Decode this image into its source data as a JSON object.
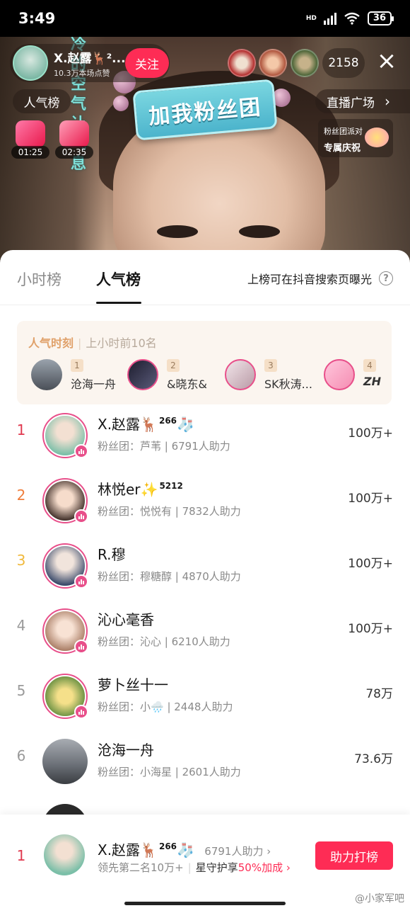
{
  "status": {
    "time": "3:49",
    "hd": "HD",
    "battery": "36"
  },
  "stream": {
    "sign_text": "加我粉丝团",
    "vert_text": "冷的空气让气息",
    "streamer_name": "X.赵露🦌²...",
    "streamer_likes": "10.3万本场点赞",
    "follow": "关注",
    "viewer_count": "2158",
    "popularity_chip": "人气榜",
    "plaza_chip": "直播广场",
    "gift_timers": [
      "01:25",
      "02:35"
    ],
    "fan_party": {
      "line1": "粉丝团派对",
      "line2": "专属庆祝"
    }
  },
  "tabs": {
    "hourly": "小时榜",
    "popularity": "人气榜",
    "exposure": "上榜可在抖音搜索页曝光",
    "help": "?"
  },
  "moment": {
    "title": "人气时刻",
    "subtitle": "上小时前10名",
    "items": [
      {
        "rank": "1",
        "name": "沧海一舟"
      },
      {
        "rank": "2",
        "name": "&晓东&"
      },
      {
        "rank": "3",
        "name": "SK秋涛..."
      },
      {
        "rank": "4",
        "name": "ZH"
      }
    ]
  },
  "ranking": [
    {
      "rank": "1",
      "name": "X.赵露🦌",
      "level": "266",
      "badge": "🧦",
      "meta": "粉丝团：芦苇 | 6791人助力",
      "score": "100万+",
      "rank_color": "#e0394f"
    },
    {
      "rank": "2",
      "name": "林悦er✨",
      "level": "5212",
      "badge": "",
      "meta": "粉丝团：悦悦有 | 7832人助力",
      "score": "100万+",
      "rank_color": "#ef7d3b"
    },
    {
      "rank": "3",
      "name": "R.穆",
      "level": "",
      "badge": "",
      "meta": "粉丝团：穆糖醇 | 4870人助力",
      "score": "100万+",
      "rank_color": "#f0b93c"
    },
    {
      "rank": "4",
      "name": "沁心毫香",
      "level": "",
      "badge": "",
      "meta": "粉丝团：沁心 | 6210人助力",
      "score": "100万+",
      "rank_color": "#9a9a9a"
    },
    {
      "rank": "5",
      "name": "萝卜丝十一",
      "level": "",
      "badge": "",
      "meta": "粉丝团：小🌧️ | 2448人助力",
      "score": "78万",
      "rank_color": "#9a9a9a"
    },
    {
      "rank": "6",
      "name": "沧海一舟",
      "level": "",
      "badge": "",
      "meta": "粉丝团：小海星 | 2601人助力",
      "score": "73.6万",
      "rank_color": "#9a9a9a"
    }
  ],
  "my_bar": {
    "rank": "1",
    "name": "X.赵露🦌",
    "level": "266",
    "badge": "🧦",
    "assist": "6791人助力 ›",
    "lead": "领先第二名10万+",
    "guard": "星守护享",
    "pct": "50%加成 ›",
    "button": "助力打榜",
    "watermark": "@小家军吧"
  },
  "colors": {
    "accent": "#fe2c55",
    "rank1": "#e0394f",
    "rank2": "#ef7d3b",
    "rank3": "#f0b93c",
    "moment_title": "#e0a16a"
  }
}
